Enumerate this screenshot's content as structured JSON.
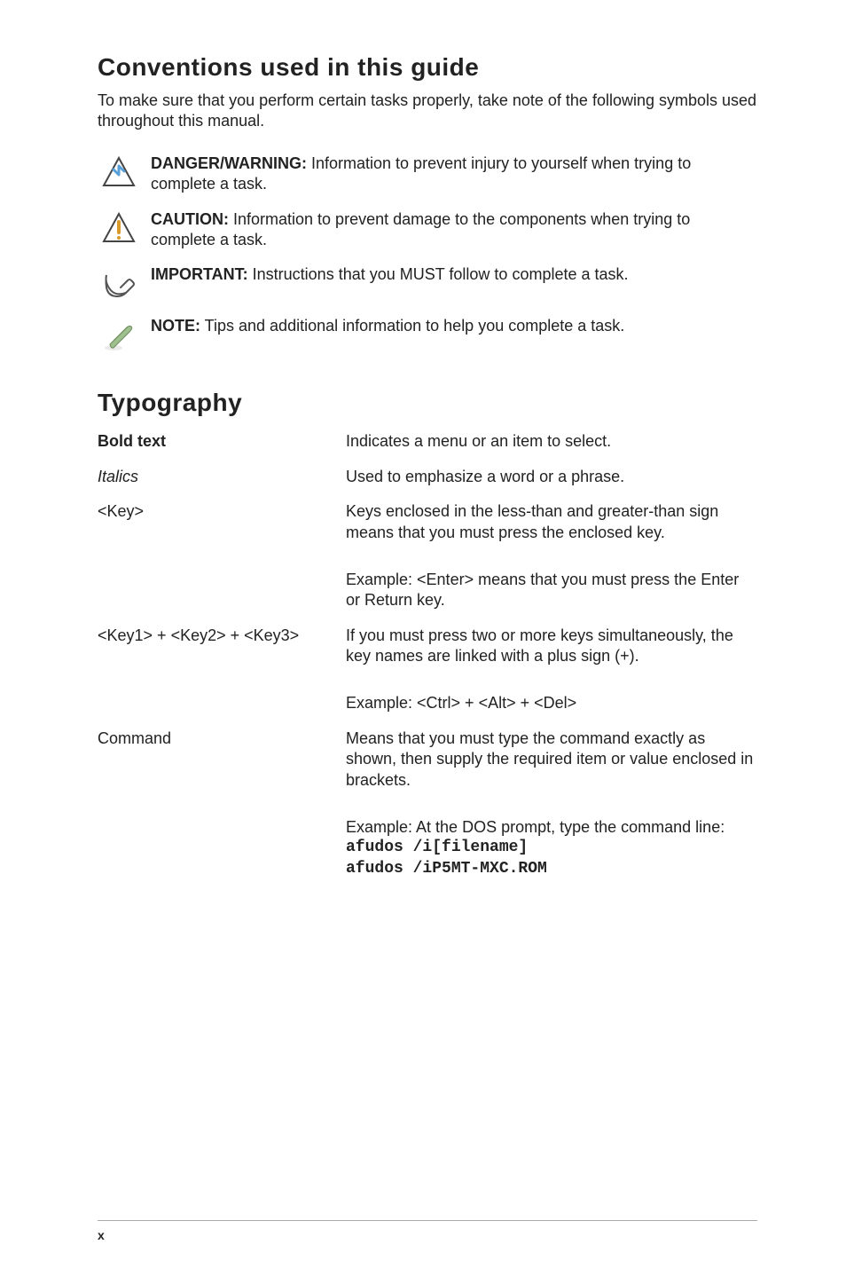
{
  "conventions": {
    "heading": "Conventions used in this guide",
    "intro": "To make sure that you perform certain tasks properly, take note of the following symbols used throughout this manual.",
    "danger": {
      "lead": "DANGER/WARNING:",
      "body": " Information to prevent injury to yourself when trying to complete a task."
    },
    "caution": {
      "lead": "CAUTION:",
      "body": " Information to prevent damage to the components when trying to complete a task."
    },
    "important": {
      "lead": "IMPORTANT:",
      "body": " Instructions that you MUST follow to complete a task."
    },
    "note": {
      "lead": "NOTE:",
      "body": " Tips and additional information to help you complete a task."
    }
  },
  "typography": {
    "heading": "Typography",
    "rows": {
      "bold": {
        "label": "Bold text",
        "desc": "Indicates a menu or an item to select."
      },
      "italics": {
        "label": "Italics",
        "desc": "Used to emphasize a word or a phrase."
      },
      "key": {
        "label": "<Key>",
        "desc1": "Keys enclosed in the less-than and greater-than sign means that you must press the enclosed key.",
        "desc2": "Example: <Enter> means that you must press the Enter or Return key."
      },
      "keyCombo": {
        "label": "<Key1> + <Key2> + <Key3>",
        "desc1": "If you must press two or more keys simultaneously, the key names are linked with a plus sign (+).",
        "desc2": "Example: <Ctrl> + <Alt> + <Del>"
      },
      "command": {
        "label": "Command",
        "desc1": "Means that you must type the command exactly as shown, then supply the required item or value enclosed in brackets.",
        "desc2a": "Example: At the DOS prompt, type the command line:",
        "mono1": "afudos /i[filename]",
        "mono2": "afudos /iP5MT-MXC.ROM"
      }
    }
  },
  "footer": {
    "pageNumber": "x"
  }
}
